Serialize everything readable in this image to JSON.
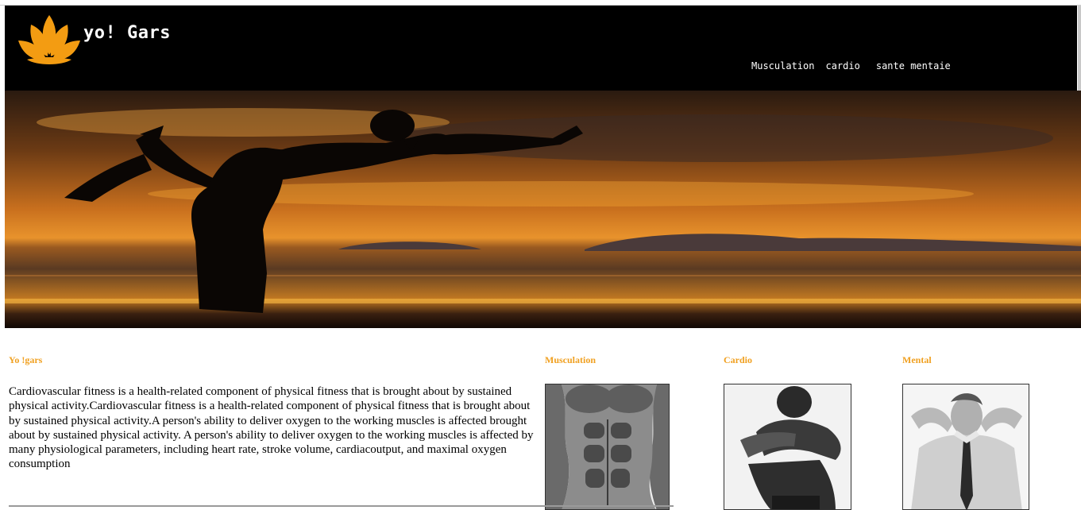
{
  "header": {
    "title": "yo! Gars",
    "nav": [
      "Musculation",
      "cardio",
      "sante mentaie"
    ],
    "logo_icon": "lotus-icon",
    "accent_color": "#f39c12"
  },
  "hero": {
    "image": "yoga-silhouette-sunset"
  },
  "columns": {
    "intro": {
      "heading": "Yo !gars",
      "text": "Cardiovascular fitness is a health-related component of physical fitness that is brought about by sustained physical activity.Cardiovascular fitness is a health-related component of physical fitness that is brought about by sustained physical activity.A person's ability to deliver oxygen to the working muscles is affected brought about by sustained physical activity. A person's ability to deliver oxygen to the working muscles is affected by many physiological parameters, including heart rate, stroke volume, cardiacoutput, and maximal oxygen consumption"
    },
    "musculation": {
      "heading": "Musculation",
      "image": "abs-torso-photo"
    },
    "cardio": {
      "heading": "Cardio",
      "image": "tired-athlete-photo"
    },
    "mental": {
      "heading": "Mental",
      "image": "relaxed-man-photo"
    }
  }
}
